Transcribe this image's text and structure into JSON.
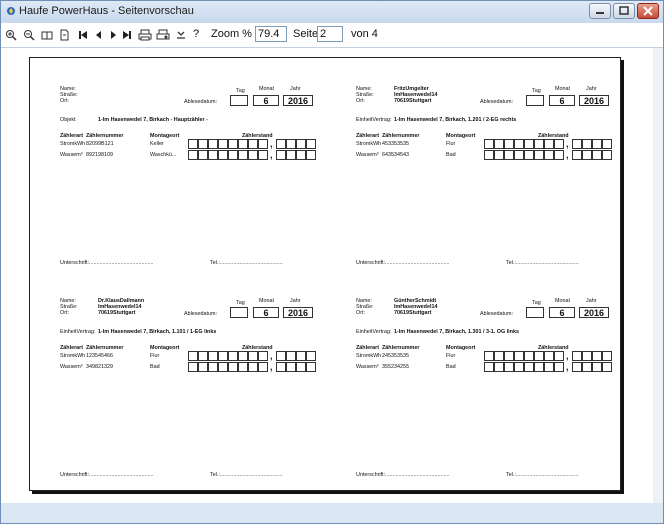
{
  "window": {
    "title": "Haufe PowerHaus - Seitenvorschau",
    "buttons": {
      "minimize": "minimize-icon",
      "maximize": "maximize-icon",
      "close": "close-icon"
    }
  },
  "toolbar": {
    "zoom_label": "Zoom %",
    "zoom_value": "79.4",
    "page_label": "Seite",
    "page_value": "2",
    "of_label": "von 4",
    "help": "?",
    "icons": [
      "zoom-in-icon",
      "zoom-out-icon",
      "two-pages-icon",
      "single-page-icon",
      "first-page-icon",
      "prev-page-icon",
      "next-page-icon",
      "last-page-icon",
      "print-icon",
      "print-setup-icon",
      "export-icon",
      "help-icon"
    ]
  },
  "labels": {
    "name": "Name:",
    "strasse": "Straße:",
    "ort": "Ort:",
    "tag": "Tag",
    "monat": "Monat",
    "jahr": "Jahr",
    "ablesedatum": "Ablesedatum:",
    "zaehlerart": "Zählerart",
    "zaehlernummer": "Zählernummer",
    "montageort": "Montageort",
    "zaehlerstand": "Zählerstand",
    "unterschrift": "Unterschrift:...........................................",
    "tel": "Tel.:..........................................",
    "monat_value": "6",
    "jahr_value": "2016",
    "comma": ","
  },
  "cards": [
    {
      "name": "",
      "strasse": "",
      "ort": "",
      "objekt_label": "Objekt",
      "objekt": "1-Im Hasenwedel 7, Birkach     - Hauptzähler -",
      "rows": [
        {
          "art": "StromkWh",
          "nummer": "82099B121",
          "ort": "Keller"
        },
        {
          "art": "Wassem³",
          "nummer": "892198109",
          "ort": "Waschkü..."
        }
      ]
    },
    {
      "name": "FritzUmgelter",
      "strasse": "ImHasenwedel14",
      "ort": "70619Stuttgart",
      "objekt_label": "EinheitVertrag:",
      "objekt": "1-Im Hasenwedel 7, Birkach, 1.201 / 2-EG rechts",
      "rows": [
        {
          "art": "StromkWh",
          "nummer": "453353535",
          "ort": "Flur"
        },
        {
          "art": "Wassem³",
          "nummer": "643534543",
          "ort": "Bad"
        }
      ]
    },
    {
      "name": "Dr.KlausDallmann",
      "strasse": "ImHasenwedel14",
      "ort": "70619Stuttgart",
      "objekt_label": "EinheitVertrag:",
      "objekt": "1-Im Hasenwedel 7, Birkach, 1.101 / 1-EG links",
      "rows": [
        {
          "art": "StromkWh",
          "nummer": "123545466",
          "ort": "Flur"
        },
        {
          "art": "Wassem³",
          "nummer": "349821329",
          "ort": "Bad"
        }
      ]
    },
    {
      "name": "GüntherSchmidt",
      "strasse": "ImHasenwedel14",
      "ort": "70619Stuttgart",
      "objekt_label": "EinheitVertrag:",
      "objekt": "1-Im Hasenwedel 7, Birkach, 1.301 / 3-1. OG links",
      "rows": [
        {
          "art": "StromkWh",
          "nummer": "245353535",
          "ort": "Flur"
        },
        {
          "art": "Wassem³",
          "nummer": "355234255",
          "ort": "Bad"
        }
      ]
    }
  ]
}
